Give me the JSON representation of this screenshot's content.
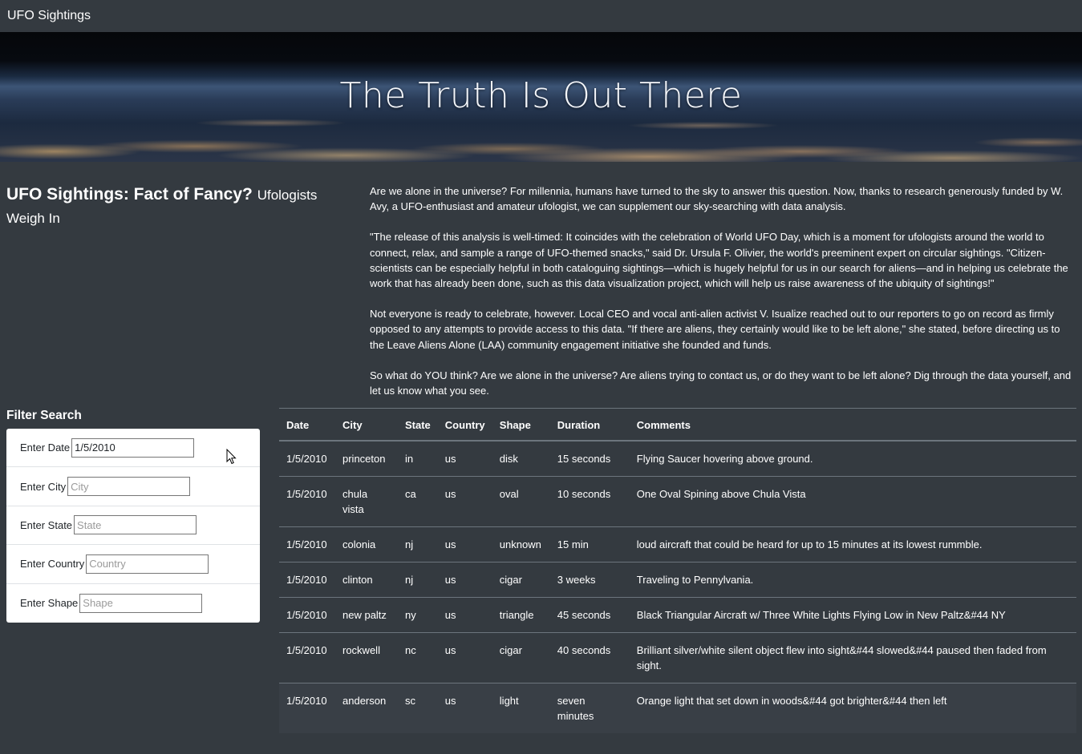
{
  "navbar": {
    "brand": "UFO Sightings"
  },
  "hero": {
    "title": "The Truth Is Out There"
  },
  "intro": {
    "heading": "UFO Sightings: Fact of Fancy?",
    "subheading": "Ufologists Weigh In",
    "paragraphs": [
      "Are we alone in the universe? For millennia, humans have turned to the sky to answer this question. Now, thanks to research generously funded by W. Avy, a UFO-enthusiast and amateur ufologist, we can supplement our sky-searching with data analysis.",
      "\"The release of this analysis is well-timed: It coincides with the celebration of World UFO Day, which is a moment for ufologists around the world to connect, relax, and sample a range of UFO-themed snacks,\" said Dr. Ursula F. Olivier, the world's preeminent expert on circular sightings. \"Citizen-scientists can be especially helpful in both cataloguing sightings—which is hugely helpful for us in our search for aliens—and in helping us celebrate the work that has already been done, such as this data visualization project, which will help us raise awareness of the ubiquity of sightings!\"",
      "Not everyone is ready to celebrate, however. Local CEO and vocal anti-alien activist V. Isualize reached out to our reporters to go on record as firmly opposed to any attempts to provide access to this data. \"If there are aliens, they certainly would like to be left alone,\" she stated, before directing us to the Leave Aliens Alone (LAA) community engagement initiative she founded and funds.",
      "So what do YOU think? Are we alone in the universe? Are aliens trying to contact us, or do they want to be left alone? Dig through the data yourself, and let us know what you see."
    ]
  },
  "filters": {
    "title": "Filter Search",
    "items": [
      {
        "label": "Enter Date",
        "value": "1/5/2010",
        "placeholder": ""
      },
      {
        "label": "Enter City",
        "value": "",
        "placeholder": "City"
      },
      {
        "label": "Enter State",
        "value": "",
        "placeholder": "State"
      },
      {
        "label": "Enter Country",
        "value": "",
        "placeholder": "Country"
      },
      {
        "label": "Enter Shape",
        "value": "",
        "placeholder": "Shape"
      }
    ]
  },
  "table": {
    "headers": [
      "Date",
      "City",
      "State",
      "Country",
      "Shape",
      "Duration",
      "Comments"
    ],
    "rows": [
      [
        "1/5/2010",
        "princeton",
        "in",
        "us",
        "disk",
        "15 seconds",
        "Flying Saucer hovering above ground."
      ],
      [
        "1/5/2010",
        "chula vista",
        "ca",
        "us",
        "oval",
        "10 seconds",
        "One Oval Spining above Chula Vista"
      ],
      [
        "1/5/2010",
        "colonia",
        "nj",
        "us",
        "unknown",
        "15 min",
        "loud aircraft that could be heard for up to 15 minutes at its lowest rummble."
      ],
      [
        "1/5/2010",
        "clinton",
        "nj",
        "us",
        "cigar",
        "3 weeks",
        "Traveling to Pennylvania."
      ],
      [
        "1/5/2010",
        "new paltz",
        "ny",
        "us",
        "triangle",
        "45 seconds",
        "Black Triangular Aircraft w/ Three White Lights Flying Low in New Paltz&#44 NY"
      ],
      [
        "1/5/2010",
        "rockwell",
        "nc",
        "us",
        "cigar",
        "40 seconds",
        "Brilliant silver/white silent object flew into sight&#44 slowed&#44 paused then faded from sight."
      ],
      [
        "1/5/2010",
        "anderson",
        "sc",
        "us",
        "light",
        "seven minutes",
        "Orange light that set down in woods&#44 got brighter&#44 then left"
      ]
    ]
  }
}
